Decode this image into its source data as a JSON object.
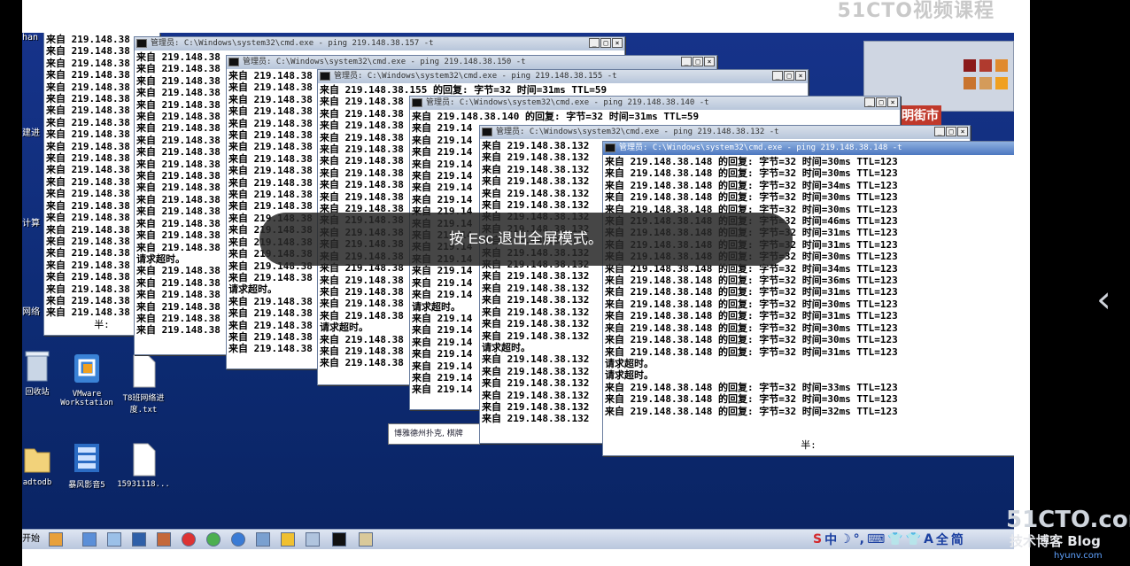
{
  "watermark_top": "51CTO视频课程",
  "edge_labels": [
    "han",
    "建进",
    "计算",
    "网络"
  ],
  "desktop_icons": [
    {
      "name": "recycle-bin",
      "label": "回收站"
    },
    {
      "name": "vmware",
      "label": "VMware Workstation"
    },
    {
      "name": "txt-file",
      "label": "T8班网络进度.txt"
    },
    {
      "name": "folder",
      "label": "adtodb"
    },
    {
      "name": "storm-player",
      "label": "暴风影音5"
    },
    {
      "name": "file-1593",
      "label": "15931118..."
    }
  ],
  "windows": {
    "w1": {
      "title": "",
      "lines": [
        "来自 219.148.38",
        "来自 219.148.38",
        "来自 219.148.38",
        "来自 219.148.38",
        "来自 219.148.38",
        "来自 219.148.38",
        "来自 219.148.38",
        "来自 219.148.38",
        "来自 219.148.38",
        "来自 219.148.38",
        "来自 219.148.38",
        "来自 219.148.38",
        "来自 219.148.38",
        "来自 219.148.38",
        "来自 219.148.38",
        "来自 219.148.38",
        "来自 219.148.38",
        "来自 219.148.38",
        "来自 219.148.38",
        "来自 219.148.38",
        "来自 219.148.38",
        "来自 219.148.38",
        "来自 219.148.38",
        "来自 219.148.38"
      ],
      "foot": "半:"
    },
    "w2": {
      "title": "管理员: C:\\Windows\\system32\\cmd.exe - ping  219.148.38.157 -t",
      "lines": [
        "来自 219.148.38",
        "来自 219.148.38",
        "来自 219.148.38",
        "来自 219.148.38",
        "来自 219.148.38",
        "来自 219.148.38",
        "来自 219.148.38",
        "来自 219.148.38",
        "来自 219.148.38",
        "来自 219.148.38",
        "来自 219.148.38",
        "来自 219.148.38",
        "来自 219.148.38",
        "来自 219.148.38",
        "来自 219.148.38",
        "来自 219.148.38",
        "来自 219.148.38",
        "请求超时。",
        "来自 219.148.38",
        "来自 219.148.38",
        "来自 219.148.38",
        "来自 219.148.38",
        "来自 219.148.38",
        "来自 219.148.38"
      ],
      "foot": "半:"
    },
    "w3": {
      "title": "管理员: C:\\Windows\\system32\\cmd.exe - ping  219.148.38.150 -t",
      "lines": [
        "来自 219.148.38",
        "来自 219.148.38",
        "来自 219.148.38",
        "来自 219.148.38",
        "来自 219.148.38",
        "来自 219.148.38",
        "来自 219.148.38",
        "来自 219.148.38",
        "来自 219.148.38",
        "来自 219.148.38",
        "来自 219.148.38",
        "来自 219.148.38",
        "来自 219.148.38",
        "来自 219.148.38",
        "来自 219.148.38",
        "来自 219.148.38",
        "来自 219.148.38",
        "来自 219.148.38",
        "请求超时。",
        "来自 219.148.38",
        "来自 219.148.38",
        "来自 219.148.38",
        "来自 219.148.38",
        "来自 219.148.38"
      ],
      "foot": "半:"
    },
    "w4": {
      "title": "管理员: C:\\Windows\\system32\\cmd.exe - ping  219.148.38.155 -t",
      "lines": [
        "来自 219.148.38.155 的回复: 字节=32 时间=31ms TTL=59",
        "来自 219.148.38",
        "来自 219.148.38",
        "来自 219.148.38",
        "来自 219.148.38",
        "来自 219.148.38",
        "来自 219.148.38",
        "来自 219.148.38",
        "来自 219.148.38",
        "来自 219.148.38",
        "来自 219.148.38",
        "来自 219.148.38",
        "来自 219.148.38",
        "来自 219.148.38",
        "来自 219.148.38",
        "来自 219.148.38",
        "来自 219.148.38",
        "来自 219.148.38",
        "来自 219.148.38",
        "来自 219.148.38",
        "请求超时。",
        "来自 219.148.38",
        "来自 219.148.38",
        "来自 219.148.38"
      ],
      "foot": "半:"
    },
    "w5": {
      "title": "管理员: C:\\Windows\\system32\\cmd.exe - ping  219.148.38.140 -t",
      "lines": [
        "来自 219.148.38.140 的回复: 字节=32 时间=31ms TTL=59",
        "来自 219.14",
        "来自 219.14",
        "来自 219.14",
        "来自 219.14",
        "来自 219.14",
        "来自 219.14",
        "来自 219.14",
        "来自 219.14",
        "来自 219.14",
        "来自 219.14",
        "来自 219.14",
        "来自 219.14",
        "来自 219.14",
        "来自 219.14",
        "来自 219.14",
        "请求超时。",
        "来自 219.14",
        "来自 219.14",
        "来自 219.14",
        "来自 219.14",
        "来自 219.14",
        "来自 219.14",
        "来自 219.14"
      ],
      "foot": ""
    },
    "w6": {
      "title": "管理员: C:\\Windows\\system32\\cmd.exe - ping  219.148.38.132 -t",
      "lines": [
        "来自 219.148.38.132",
        "来自 219.148.38.132",
        "来自 219.148.38.132",
        "来自 219.148.38.132",
        "来自 219.148.38.132",
        "来自 219.148.38.132",
        "来自 219.148.38.132",
        "来自 219.148.38.132",
        "来自 219.148.38.132",
        "来自 219.148.38.132",
        "来自 219.148.38.132",
        "来自 219.148.38.132",
        "来自 219.148.38.132",
        "来自 219.148.38.132",
        "来自 219.148.38.132",
        "来自 219.148.38.132",
        "来自 219.148.38.132",
        "请求超时。",
        "来自 219.148.38.132",
        "来自 219.148.38.132",
        "来自 219.148.38.132",
        "来自 219.148.38.132",
        "来自 219.148.38.132",
        "来自 219.148.38.132"
      ],
      "foot": "半:"
    },
    "w7": {
      "title": "管理员: C:\\Windows\\system32\\cmd.exe - ping  219.148.38.148 -t",
      "lines": [
        "来自 219.148.38.148 的回复: 字节=32 时间=30ms TTL=123",
        "来自 219.148.38.148 的回复: 字节=32 时间=30ms TTL=123",
        "来自 219.148.38.148 的回复: 字节=32 时间=34ms TTL=123",
        "来自 219.148.38.148 的回复: 字节=32 时间=30ms TTL=123",
        "来自 219.148.38.148 的回复: 字节=32 时间=30ms TTL=123",
        "来自 219.148.38.148 的回复: 字节=32 时间=46ms TTL=123",
        "来自 219.148.38.148 的回复: 字节=32 时间=31ms TTL=123",
        "来自 219.148.38.148 的回复: 字节=32 时间=31ms TTL=123",
        "来自 219.148.38.148 的回复: 字节=32 时间=30ms TTL=123",
        "来自 219.148.38.148 的回复: 字节=32 时间=34ms TTL=123",
        "来自 219.148.38.148 的回复: 字节=32 时间=36ms TTL=123",
        "来自 219.148.38.148 的回复: 字节=32 时间=31ms TTL=123",
        "来自 219.148.38.148 的回复: 字节=32 时间=30ms TTL=123",
        "来自 219.148.38.148 的回复: 字节=32 时间=31ms TTL=123",
        "来自 219.148.38.148 的回复: 字节=32 时间=30ms TTL=123",
        "来自 219.148.38.148 的回复: 字节=32 时间=30ms TTL=123",
        "来自 219.148.38.148 的回复: 字节=32 时间=31ms TTL=123",
        "请求超时。",
        "请求超时。",
        "来自 219.148.38.148 的回复: 字节=32 时间=33ms TTL=123",
        "来自 219.148.38.148 的回复: 字节=32 时间=30ms TTL=123",
        "来自 219.148.38.148 的回复: 字节=32 时间=32ms TTL=123"
      ],
      "foot": "半:"
    }
  },
  "balloon_text": "博雅德州扑克, 棋牌",
  "street_text": "明街市",
  "taskbar": {
    "start": "开始",
    "ime": [
      "S",
      "中",
      "☽",
      "°,",
      "⌨",
      "👕",
      "👕",
      "A",
      "全",
      "简"
    ]
  },
  "toast": "按 Esc 退出全屏模式。",
  "brand": {
    "logo": "51CTO.com",
    "blog": "技术博客 Blog",
    "url": "hyunv.com"
  },
  "colors": {
    "desktop": "#0d2b73",
    "toast_bg": "#282828",
    "active_title": "#4c77c0"
  }
}
